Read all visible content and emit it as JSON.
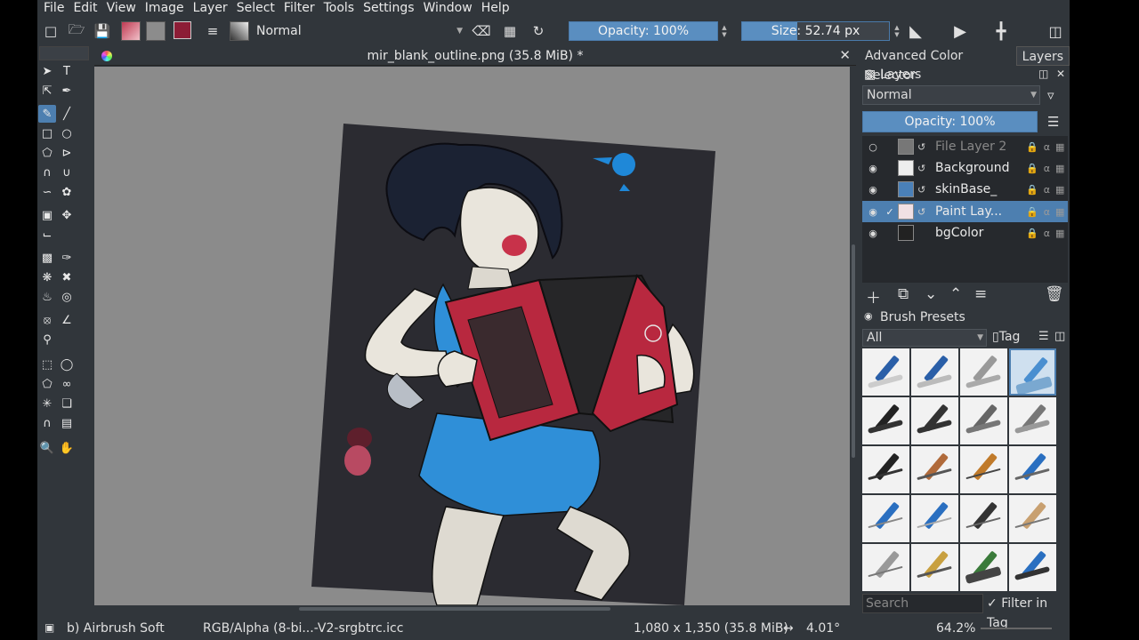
{
  "menu": [
    "File",
    "Edit",
    "View",
    "Image",
    "Layer",
    "Select",
    "Filter",
    "Tools",
    "Settings",
    "Window",
    "Help"
  ],
  "toolbar": {
    "blend_mode": "Normal",
    "opacity_label": "Opacity: 100%",
    "size_label": "Size: 52.74 px",
    "fg_color": "#8c1d36",
    "bg_color": "#000000"
  },
  "document": {
    "title": "mir_blank_outline.png (35.8 MiB) *"
  },
  "dockers": {
    "tabs": [
      "Advanced Color Selector",
      "Layers"
    ],
    "active_tab": "Layers"
  },
  "layers": {
    "title": "Layers",
    "blend_mode": "Normal",
    "opacity_label": "Opacity:  100%",
    "items": [
      {
        "name": "File Layer 2",
        "visible": false,
        "selected": false
      },
      {
        "name": "Background",
        "visible": true,
        "selected": false
      },
      {
        "name": "skinBase_",
        "visible": true,
        "selected": false
      },
      {
        "name": "Paint Lay...",
        "visible": true,
        "selected": true
      },
      {
        "name": "bgColor",
        "visible": true,
        "selected": false
      }
    ]
  },
  "brush_presets": {
    "title": "Brush Presets",
    "filter": "All",
    "tag_label": "Tag",
    "search_placeholder": "Search",
    "filter_in_tag_label": "Filter in Tag"
  },
  "status": {
    "brush": "b) Airbrush Soft",
    "color_profile": "RGB/Alpha (8-bi...-V2-srgbtrc.icc",
    "image_size": "1,080 x 1,350 (35.8 MiB)",
    "rotation": "4.01°",
    "zoom": "64.2%"
  },
  "accent_color": "#4d7fb0"
}
